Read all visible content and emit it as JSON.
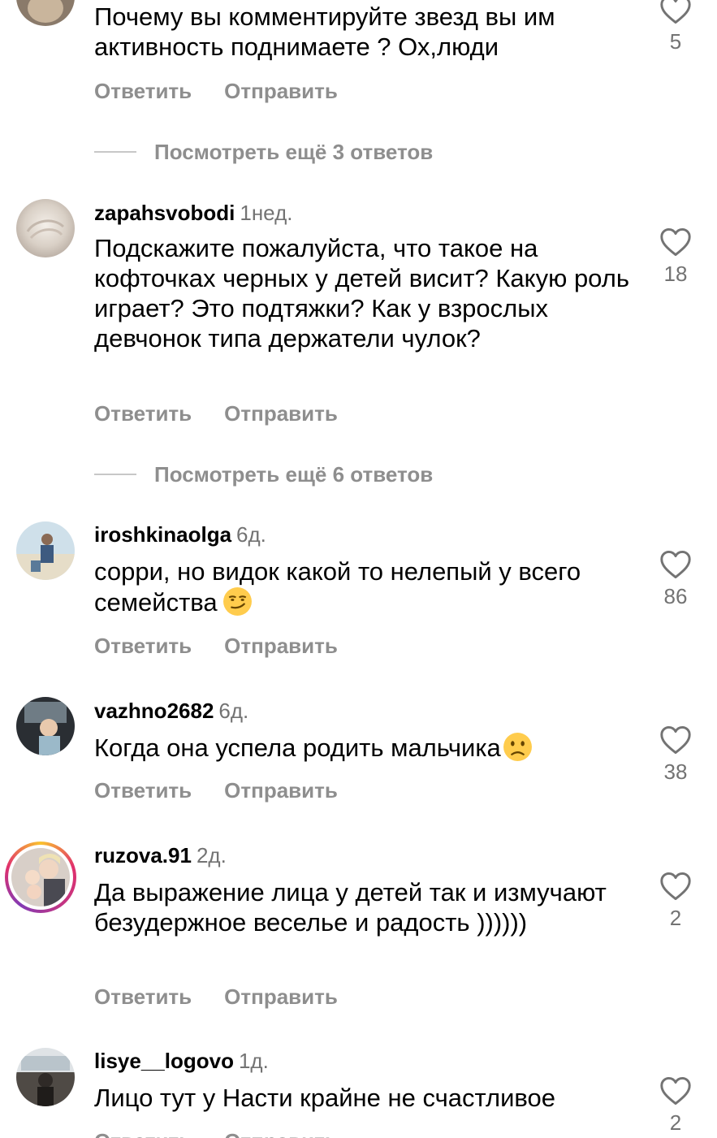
{
  "labels": {
    "reply": "Ответить",
    "send": "Отправить"
  },
  "comments": [
    {
      "username": "",
      "time": "",
      "text": "Почему вы комментируйте звезд вы им активность поднимаете ? Ох,люди",
      "likes": "5",
      "view_more": "Посмотреть ещё 3 ответов"
    },
    {
      "username": "zapahsvobodi",
      "time": "1нед.",
      "text": "Подскажите пожалуйста, что такое на кофточках черных у детей висит? Какую роль играет? Это подтяжки? Как у взрослых девчонок типа держатели чулок?",
      "likes": "18",
      "view_more": "Посмотреть ещё 6 ответов"
    },
    {
      "username": "iroshkinaolga",
      "time": "6д.",
      "text": "сорри, но видок какой то нелепый у всего семейства",
      "emoji": "smirk-emoji",
      "likes": "86"
    },
    {
      "username": "vazhno2682",
      "time": "6д.",
      "text": "Когда она успела родить мальчика",
      "emoji": "confused-emoji",
      "likes": "38"
    },
    {
      "username": "ruzova.91",
      "time": "2д.",
      "text": "Да выражение лица у детей так и измучают безудержное веселье и радость ))))))",
      "likes": "2",
      "story_ring": true
    },
    {
      "username": "lisye__logovo",
      "time": "1д.",
      "text": "Лицо тут у Насти крайне не счастливое",
      "likes": "2"
    }
  ],
  "colors": {
    "secondary_text": "#737373",
    "action_text": "#8e8e8e",
    "story_ring": [
      "#f9c22e",
      "#e1306c",
      "#833ab4"
    ]
  }
}
